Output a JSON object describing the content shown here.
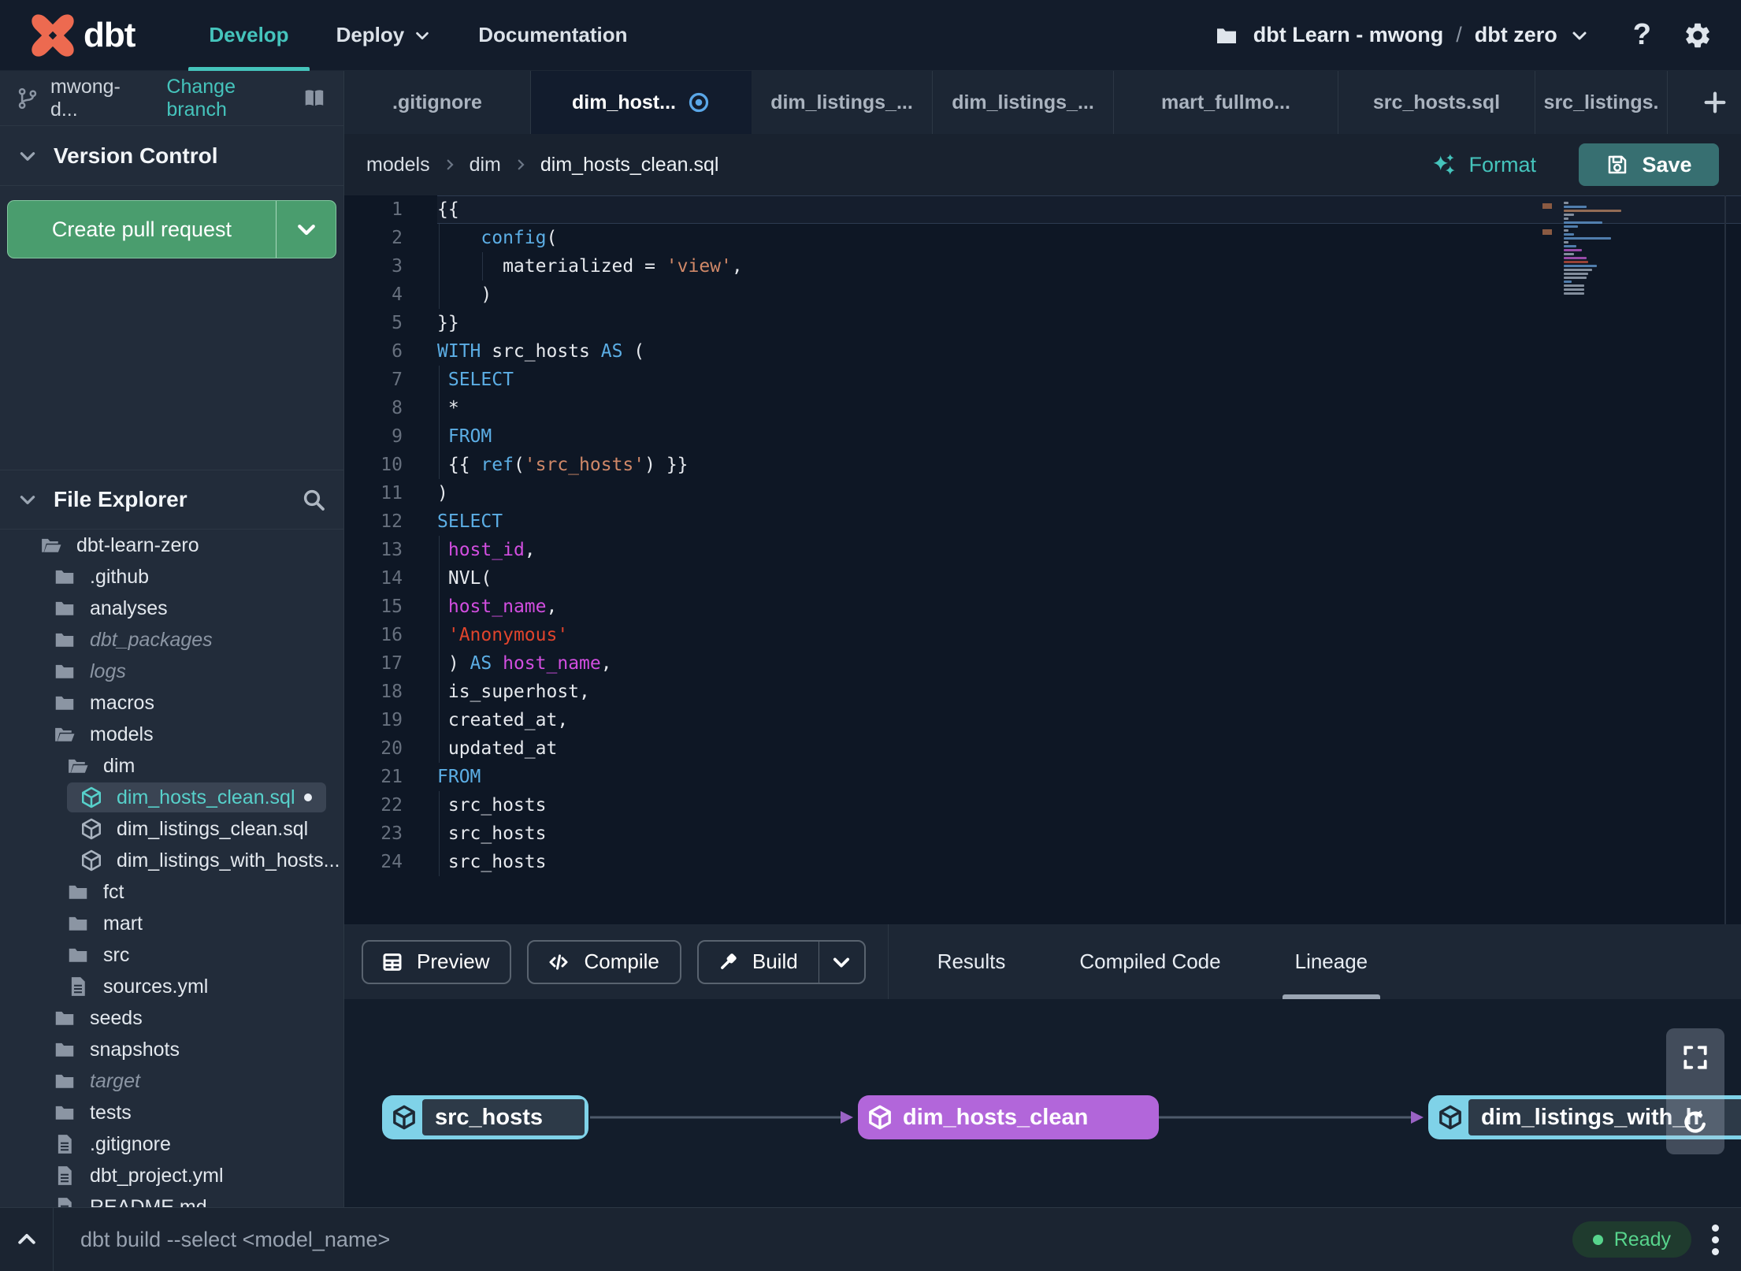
{
  "navbar": {
    "brand": "dbt",
    "menu": [
      {
        "label": "Develop",
        "active": true
      },
      {
        "label": "Deploy",
        "chevron": true
      },
      {
        "label": "Documentation"
      }
    ],
    "project": {
      "account": "dbt Learn - mwong",
      "separator": "/",
      "name": "dbt zero"
    }
  },
  "sidebar": {
    "branch": {
      "name": "mwong-d...",
      "change_link": "Change branch"
    },
    "version_control": {
      "title": "Version Control",
      "create_pr_label": "Create pull request"
    },
    "file_explorer": {
      "title": "File Explorer",
      "tree": [
        {
          "name": "dbt-learn-zero",
          "type": "folder-open",
          "level": 0
        },
        {
          "name": ".github",
          "type": "folder",
          "level": 1
        },
        {
          "name": "analyses",
          "type": "folder",
          "level": 1
        },
        {
          "name": "dbt_packages",
          "type": "folder",
          "level": 1,
          "dim": true
        },
        {
          "name": "logs",
          "type": "folder",
          "level": 1,
          "dim": true
        },
        {
          "name": "macros",
          "type": "folder",
          "level": 1
        },
        {
          "name": "models",
          "type": "folder-open",
          "level": 1
        },
        {
          "name": "dim",
          "type": "folder-open",
          "level": 2
        },
        {
          "name": "dim_hosts_clean.sql",
          "type": "model",
          "level": 3,
          "selected": true,
          "modified": true
        },
        {
          "name": "dim_listings_clean.sql",
          "type": "model",
          "level": 3
        },
        {
          "name": "dim_listings_with_hosts...",
          "type": "model",
          "level": 3
        },
        {
          "name": "fct",
          "type": "folder",
          "level": 2
        },
        {
          "name": "mart",
          "type": "folder",
          "level": 2
        },
        {
          "name": "src",
          "type": "folder",
          "level": 2
        },
        {
          "name": "sources.yml",
          "type": "file",
          "level": 2
        },
        {
          "name": "seeds",
          "type": "folder",
          "level": 1
        },
        {
          "name": "snapshots",
          "type": "folder",
          "level": 1
        },
        {
          "name": "target",
          "type": "folder",
          "level": 1,
          "dim": true
        },
        {
          "name": "tests",
          "type": "folder",
          "level": 1
        },
        {
          "name": ".gitignore",
          "type": "file",
          "level": 1
        },
        {
          "name": "dbt_project.yml",
          "type": "file",
          "level": 1
        },
        {
          "name": "README.md",
          "type": "file",
          "level": 1
        }
      ]
    }
  },
  "tabs": [
    {
      "label": ".gitignore"
    },
    {
      "label": "dim_host...",
      "active": true,
      "unsaved": true
    },
    {
      "label": "dim_listings_..."
    },
    {
      "label": "dim_listings_..."
    },
    {
      "label": "mart_fullmo..."
    },
    {
      "label": "src_hosts.sql"
    },
    {
      "label": "src_listings."
    }
  ],
  "editor_header": {
    "breadcrumb": [
      "models",
      "dim",
      "dim_hosts_clean.sql"
    ],
    "format_label": "Format",
    "save_label": "Save"
  },
  "editor": {
    "language": "sql",
    "lines": [
      {
        "n": 1,
        "highlight": true,
        "tokens": [
          [
            "p",
            "{{"
          ]
        ]
      },
      {
        "n": 2,
        "guides": [
          0
        ],
        "tokens": [
          [
            "p",
            "    "
          ],
          [
            "k",
            "config"
          ],
          [
            "p",
            "("
          ]
        ]
      },
      {
        "n": 3,
        "guides": [
          0,
          4
        ],
        "tokens": [
          [
            "p",
            "      materialized = "
          ],
          [
            "s",
            "'view'"
          ],
          [
            "p",
            ","
          ]
        ]
      },
      {
        "n": 4,
        "guides": [
          0
        ],
        "tokens": [
          [
            "p",
            "    )"
          ]
        ]
      },
      {
        "n": 5,
        "tokens": [
          [
            "p",
            "}}"
          ]
        ]
      },
      {
        "n": 6,
        "tokens": [
          [
            "k",
            "WITH"
          ],
          [
            "p",
            " src_hosts "
          ],
          [
            "k",
            "AS"
          ],
          [
            "p",
            " ("
          ]
        ]
      },
      {
        "n": 7,
        "guides": [
          0
        ],
        "tokens": [
          [
            "p",
            " "
          ],
          [
            "k",
            "SELECT"
          ]
        ]
      },
      {
        "n": 8,
        "guides": [
          0
        ],
        "tokens": [
          [
            "p",
            " *"
          ]
        ]
      },
      {
        "n": 9,
        "guides": [
          0
        ],
        "tokens": [
          [
            "p",
            " "
          ],
          [
            "k",
            "FROM"
          ]
        ]
      },
      {
        "n": 10,
        "guides": [
          0
        ],
        "tokens": [
          [
            "p",
            " {{ "
          ],
          [
            "k",
            "ref"
          ],
          [
            "p",
            "("
          ],
          [
            "s",
            "'src_hosts'"
          ],
          [
            "p",
            ") }}"
          ]
        ]
      },
      {
        "n": 11,
        "tokens": [
          [
            "p",
            ")"
          ]
        ]
      },
      {
        "n": 12,
        "tokens": [
          [
            "k",
            "SELECT"
          ]
        ]
      },
      {
        "n": 13,
        "guides": [
          0
        ],
        "tokens": [
          [
            "p",
            " "
          ],
          [
            "i",
            "host_id"
          ],
          [
            "p",
            ","
          ]
        ]
      },
      {
        "n": 14,
        "guides": [
          0
        ],
        "tokens": [
          [
            "p",
            " NVL("
          ]
        ]
      },
      {
        "n": 15,
        "guides": [
          0
        ],
        "tokens": [
          [
            "p",
            " "
          ],
          [
            "i",
            "host_name"
          ],
          [
            "p",
            ","
          ]
        ]
      },
      {
        "n": 16,
        "guides": [
          0
        ],
        "tokens": [
          [
            "p",
            " "
          ],
          [
            "r",
            "'Anonymous'"
          ]
        ]
      },
      {
        "n": 17,
        "guides": [
          0
        ],
        "tokens": [
          [
            "p",
            " ) "
          ],
          [
            "k",
            "AS"
          ],
          [
            "p",
            " "
          ],
          [
            "i",
            "host_name"
          ],
          [
            "p",
            ","
          ]
        ]
      },
      {
        "n": 18,
        "guides": [
          0
        ],
        "tokens": [
          [
            "p",
            " is_superhost,"
          ]
        ]
      },
      {
        "n": 19,
        "guides": [
          0
        ],
        "tokens": [
          [
            "p",
            " created_at,"
          ]
        ]
      },
      {
        "n": 20,
        "guides": [
          0
        ],
        "tokens": [
          [
            "p",
            " updated_at"
          ]
        ]
      },
      {
        "n": 21,
        "tokens": [
          [
            "k",
            "FROM"
          ]
        ]
      },
      {
        "n": 22,
        "guides": [
          0
        ],
        "tokens": [
          [
            "p",
            " src_hosts"
          ]
        ]
      },
      {
        "n": 23,
        "guides": [
          0
        ],
        "tokens": [
          [
            "p",
            " src_hosts"
          ]
        ]
      },
      {
        "n": 24,
        "guides": [
          0
        ],
        "tokens": [
          [
            "p",
            " src_hosts"
          ]
        ]
      }
    ]
  },
  "bottom_panel": {
    "buttons": [
      {
        "label": "Preview",
        "icon": "grid"
      },
      {
        "label": "Compile",
        "icon": "code"
      },
      {
        "label": "Build",
        "icon": "hammer",
        "split": true
      }
    ],
    "tabs": [
      {
        "label": "Results"
      },
      {
        "label": "Compiled Code"
      },
      {
        "label": "Lineage",
        "active": true
      }
    ]
  },
  "lineage": {
    "nodes": [
      {
        "label": "src_hosts",
        "style": "cyan"
      },
      {
        "label": "dim_hosts_clean",
        "style": "purple"
      },
      {
        "label": "dim_listings_with_h",
        "style": "cyan"
      }
    ]
  },
  "status_bar": {
    "command": "dbt build --select <model_name>",
    "status": "Ready"
  },
  "colors": {
    "accent_teal": "#45c4bc",
    "pr_green": "#4a9d6e",
    "save_teal": "#376f71",
    "node_cyan": "#7fd2e8",
    "node_purple": "#b266da",
    "ready_green": "#57d48c",
    "unsaved_blue": "#5aa7e8",
    "code_keyword": "#5caee5",
    "code_string": "#d08868",
    "code_string_red": "#e0442c",
    "code_identifier": "#d24ee0"
  }
}
